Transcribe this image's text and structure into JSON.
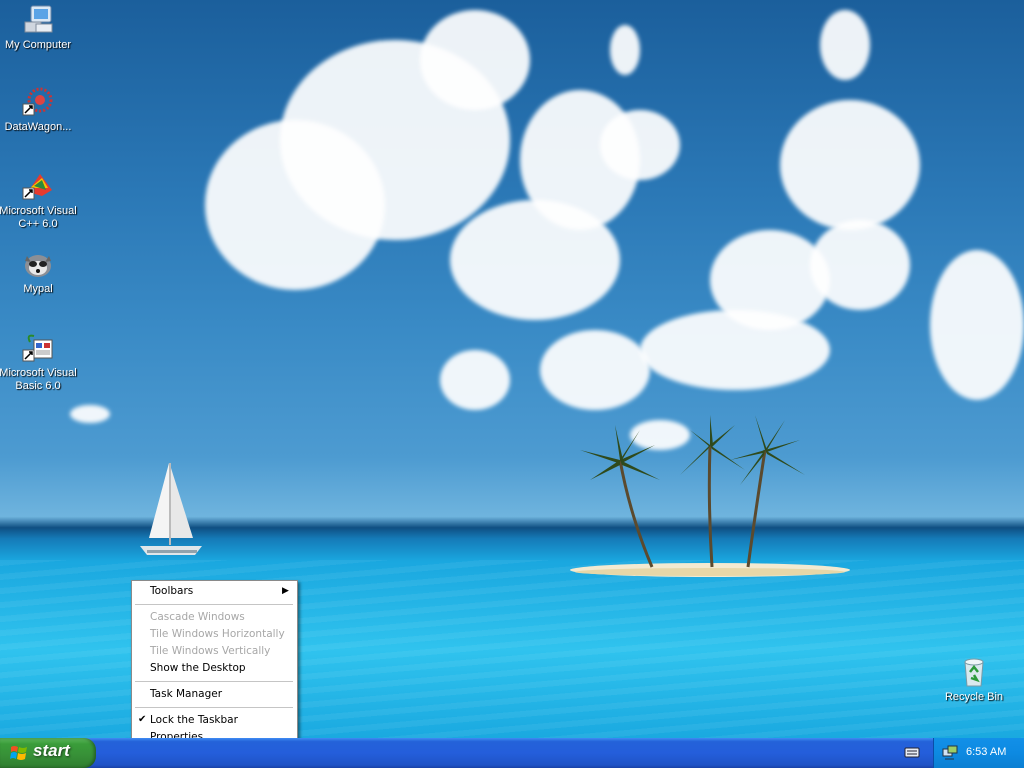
{
  "desktop": {
    "icons": [
      {
        "label": "My Computer",
        "icon": "my-computer-icon"
      },
      {
        "label": "DataWagon...",
        "icon": "datawagon-icon"
      },
      {
        "label_line1": "Microsoft Visual",
        "label_line2": "C++ 6.0",
        "icon": "visual-cpp-icon"
      },
      {
        "label": "Mypal",
        "icon": "mypal-icon"
      },
      {
        "label_line1": "Microsoft Visual",
        "label_line2": "Basic 6.0",
        "icon": "visual-basic-icon"
      }
    ],
    "recycle_bin": {
      "label": "Recycle Bin",
      "icon": "recycle-bin-icon"
    }
  },
  "context_menu": {
    "items": [
      {
        "label": "Toolbars",
        "enabled": true,
        "submenu": true
      },
      {
        "label": "Cascade Windows",
        "enabled": false
      },
      {
        "label": "Tile Windows Horizontally",
        "enabled": false
      },
      {
        "label": "Tile Windows Vertically",
        "enabled": false
      },
      {
        "label": "Show the Desktop",
        "enabled": true
      },
      {
        "label": "Task Manager",
        "enabled": true
      },
      {
        "label": "Lock the Taskbar",
        "enabled": true,
        "checked": true
      },
      {
        "label": "Properties",
        "enabled": true
      }
    ]
  },
  "taskbar": {
    "start_label": "start",
    "clock": "6:53 AM",
    "tray_icons": [
      "keyboard-icon",
      "network-icon"
    ]
  },
  "colors": {
    "taskbar_blue": "#245edb",
    "start_green": "#3a9d3a",
    "tray_blue": "#0d8ae2"
  }
}
